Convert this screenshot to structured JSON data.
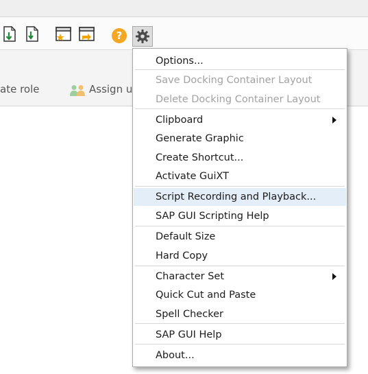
{
  "toolbar": {
    "icons": [
      "download-page-icon",
      "download-page-icon",
      "favorite-add-icon",
      "favorite-edit-icon",
      "help-icon",
      "gear-icon"
    ]
  },
  "subbar": {
    "create_role": "ate role",
    "assign": "Assign u"
  },
  "menu": {
    "items": [
      {
        "label": "Options...",
        "disabled": false
      },
      {
        "label": "Save Docking Container Layout",
        "disabled": true
      },
      {
        "label": "Delete Docking Container Layout",
        "disabled": true
      },
      {
        "label": "Clipboard",
        "submenu": true
      },
      {
        "label": "Generate Graphic"
      },
      {
        "label": "Create Shortcut..."
      },
      {
        "label": "Activate GuiXT"
      },
      {
        "label": "Script Recording and Playback...",
        "highlighted": true
      },
      {
        "label": "SAP GUI Scripting Help"
      },
      {
        "label": "Default Size"
      },
      {
        "label": "Hard Copy"
      },
      {
        "label": "Character Set",
        "submenu": true
      },
      {
        "label": "Quick Cut and Paste"
      },
      {
        "label": "Spell Checker"
      },
      {
        "label": "SAP GUI Help"
      },
      {
        "label": "About..."
      }
    ]
  },
  "colors": {
    "highlight": "#e3eef8",
    "disabled_text": "#a2a2a2",
    "help_icon": "#f5a623"
  }
}
